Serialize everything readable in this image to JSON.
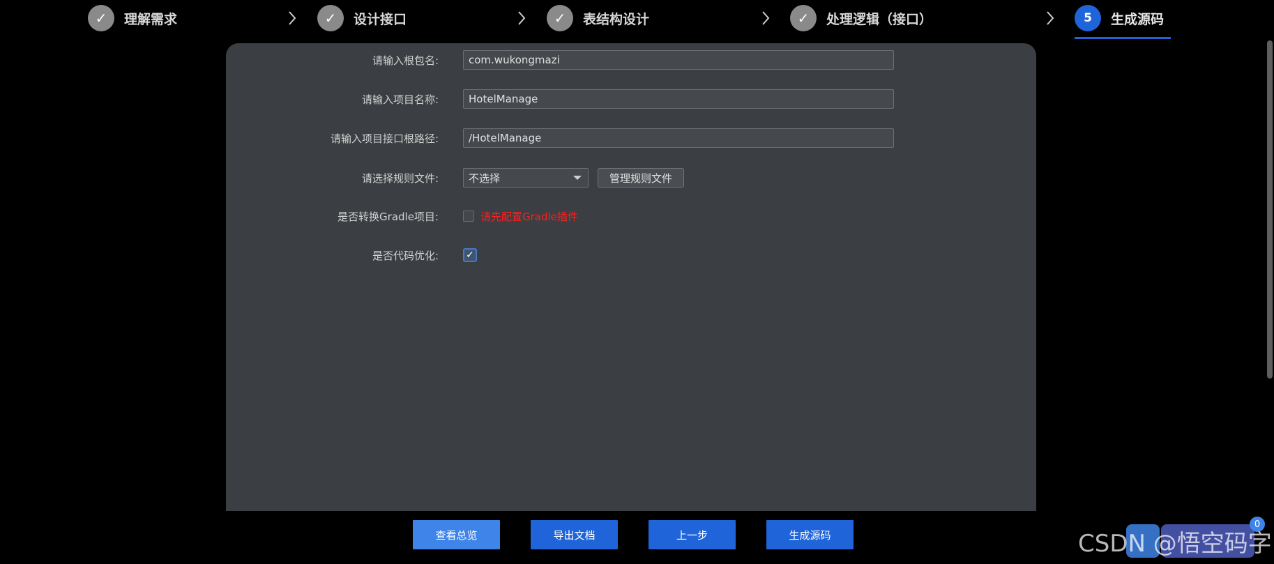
{
  "steps": [
    {
      "label": "理解需求",
      "mark": "✓"
    },
    {
      "label": "设计接口",
      "mark": "✓"
    },
    {
      "label": "表结构设计",
      "mark": "✓"
    },
    {
      "label": "处理逻辑（接口）",
      "mark": "✓"
    },
    {
      "label": "生成源码",
      "mark": "5"
    }
  ],
  "form": {
    "root_package": {
      "label": "请输入根包名:",
      "value": "com.wukongmazi"
    },
    "project_name": {
      "label": "请输入项目名称:",
      "value": "HotelManage"
    },
    "api_root_path": {
      "label": "请输入项目接口根路径:",
      "value": "/HotelManage"
    },
    "rule_file": {
      "label": "请选择规则文件:",
      "selected": "不选择",
      "manage_button": "管理规则文件"
    },
    "gradle": {
      "label": "是否转换Gradle项目:",
      "checked": false,
      "warning": "请先配置Gradle插件"
    },
    "optimize": {
      "label": "是否代码优化:",
      "checked": true,
      "mark": "✓"
    }
  },
  "buttons": {
    "overview": "查看总览",
    "export_doc": "导出文档",
    "prev_step": "上一步",
    "generate": "生成源码"
  },
  "watermark": "CSDN @悟空码字",
  "float_badge": "0",
  "colors": {
    "accent": "#1f64d9",
    "panel": "#3b3e42",
    "warning": "#ff1f1f"
  }
}
